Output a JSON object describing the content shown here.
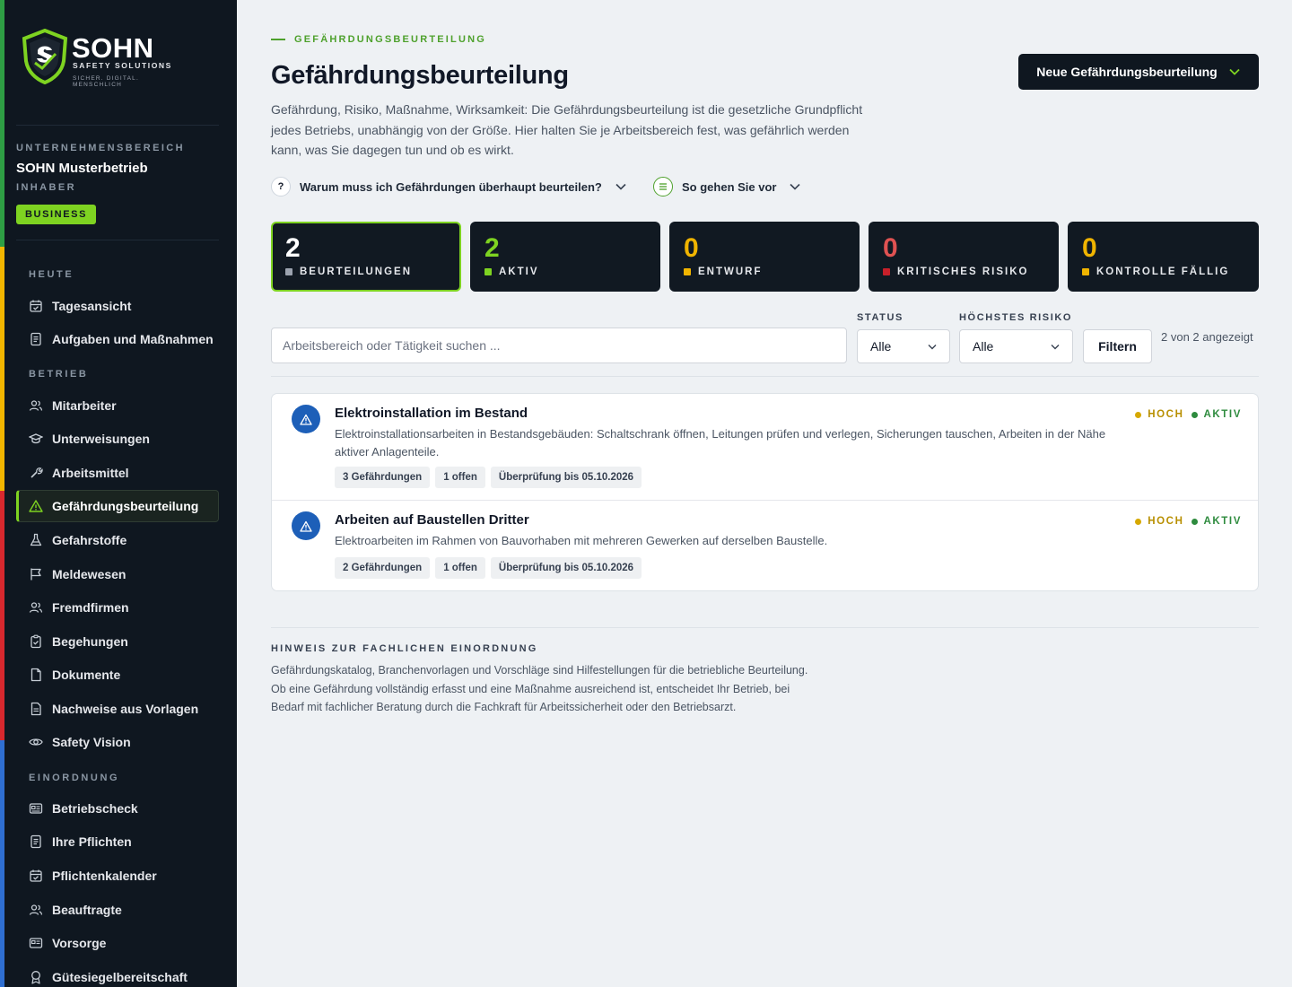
{
  "brand": {
    "name": "SOHN",
    "sub": "SAFETY SOLUTIONS",
    "tagline": "SICHER. DIGITAL. MENSCHLICH"
  },
  "sidebar": {
    "area_caption": "UNTERNEHMENSBEREICH",
    "company": "SOHN Musterbetrieb",
    "role": "INHABER",
    "plan": "BUSINESS",
    "sections": {
      "heute": "HEUTE",
      "betrieb": "BETRIEB",
      "einordnung": "EINORDNUNG"
    },
    "items": {
      "tagesansicht": "Tagesansicht",
      "aufgaben": "Aufgaben und Maßnahmen",
      "mitarbeiter": "Mitarbeiter",
      "unterweisungen": "Unterweisungen",
      "arbeitsmittel": "Arbeitsmittel",
      "gefaehrdungsbeurteilung": "Gefährdungsbeurteilung",
      "gefahrstoffe": "Gefahrstoffe",
      "meldewesen": "Meldewesen",
      "fremdfirmen": "Fremdfirmen",
      "begehungen": "Begehungen",
      "dokumente": "Dokumente",
      "nachweise": "Nachweise aus Vorlagen",
      "safety_vision": "Safety Vision",
      "betriebscheck": "Betriebscheck",
      "pflichten": "Ihre Pflichten",
      "pflichtenkalender": "Pflichtenkalender",
      "beauftragte": "Beauftragte",
      "vorsorge": "Vorsorge",
      "guetesiegel": "Gütesiegelbereitschaft"
    }
  },
  "header": {
    "eyebrow": "GEFÄHRDUNGSBEURTEILUNG",
    "title": "Gefährdungsbeurteilung",
    "description": "Gefährdung, Risiko, Maßnahme, Wirksamkeit: Die Gefährdungsbeurteilung ist die gesetzliche Grundpflicht jedes Betriebs, unabhängig von der Größe. Hier halten Sie je Arbeitsbereich fest, was gefährlich werden kann, was Sie dagegen tun und ob es wirkt.",
    "new_button": "Neue Gefährdungsbeurteilung"
  },
  "accordions": {
    "why": {
      "badge": "?",
      "label": "Warum muss ich Gefährdungen überhaupt beurteilen?"
    },
    "how": {
      "label": "So gehen Sie vor"
    }
  },
  "stats": {
    "beurteilungen": {
      "value": "2",
      "label": "BEURTEILUNGEN"
    },
    "aktiv": {
      "value": "2",
      "label": "AKTIV"
    },
    "entwurf": {
      "value": "0",
      "label": "ENTWURF"
    },
    "kritisch": {
      "value": "0",
      "label": "KRITISCHES RISIKO"
    },
    "kontrolle": {
      "value": "0",
      "label": "KONTROLLE FÄLLIG"
    }
  },
  "filters": {
    "search_placeholder": "Arbeitsbereich oder Tätigkeit suchen ...",
    "status_label": "STATUS",
    "status_value": "Alle",
    "risk_label": "HÖCHSTES RISIKO",
    "risk_value": "Alle",
    "filter_button": "Filtern",
    "count": "2 von 2 angezeigt"
  },
  "assessments": [
    {
      "title": "Elektroinstallation im Bestand",
      "description": "Elektroinstallationsarbeiten in Bestandsgebäuden: Schaltschrank öffnen, Leitungen prüfen und verlegen, Sicherungen tauschen, Arbeiten in der Nähe aktiver Anlagenteile.",
      "chips": [
        "3 Gefährdungen",
        "1 offen",
        "Überprüfung bis 05.10.2026"
      ],
      "risk": "HOCH",
      "status": "AKTIV"
    },
    {
      "title": "Arbeiten auf Baustellen Dritter",
      "description": "Elektroarbeiten im Rahmen von Bauvorhaben mit mehreren Gewerken auf derselben Baustelle.",
      "chips": [
        "2 Gefährdungen",
        "1 offen",
        "Überprüfung bis 05.10.2026"
      ],
      "risk": "HOCH",
      "status": "AKTIV"
    }
  ],
  "note": {
    "title": "HINWEIS ZUR FACHLICHEN EINORDNUNG",
    "text": "Gefährdungskatalog, Branchenvorlagen und Vorschläge sind Hilfestellungen für die betriebliche Beurteilung. Ob eine Gefährdung vollständig erfasst und eine Maßnahme ausreichend ist, entscheidet Ihr Betrieb, bei Bedarf mit fachlicher Beratung durch die Fachkraft für Arbeitssicherheit oder den Betriebsarzt."
  },
  "colors": {
    "accent_green": "#7ed321",
    "risk_high": "#d6a800",
    "status_active": "#2e8b3e",
    "critical": "#e05252",
    "warning": "#f0b400",
    "stripe": [
      "#2e9e44",
      "#f2b600",
      "#d8282e",
      "#2f6fd1"
    ]
  }
}
